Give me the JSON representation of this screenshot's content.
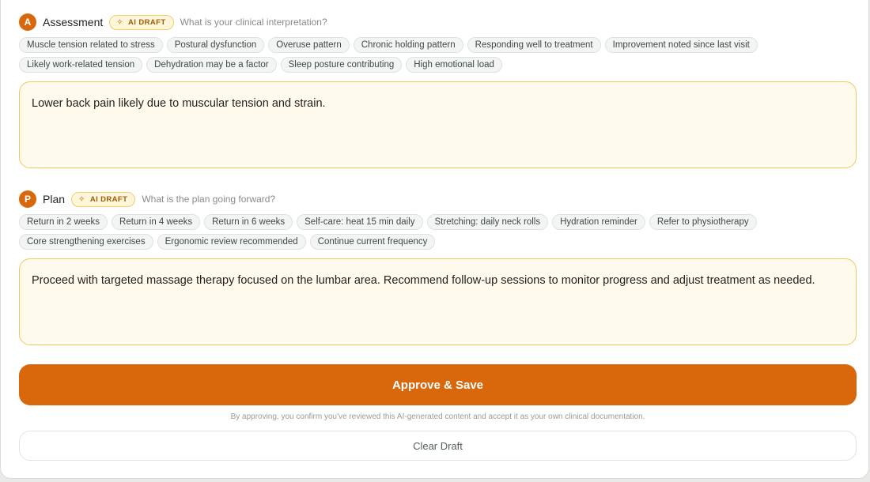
{
  "assessment": {
    "letter": "A",
    "title": "Assessment",
    "badge": "AI DRAFT",
    "prompt": "What is your clinical interpretation?",
    "chips": [
      "Muscle tension related to stress",
      "Postural dysfunction",
      "Overuse pattern",
      "Chronic holding pattern",
      "Responding well to treatment",
      "Improvement noted since last visit",
      "Likely work-related tension",
      "Dehydration may be a factor",
      "Sleep posture contributing",
      "High emotional load"
    ],
    "text": "Lower back pain likely due to muscular tension and strain."
  },
  "plan": {
    "letter": "P",
    "title": "Plan",
    "badge": "AI DRAFT",
    "prompt": "What is the plan going forward?",
    "chips": [
      "Return in 2 weeks",
      "Return in 4 weeks",
      "Return in 6 weeks",
      "Self-care: heat 15 min daily",
      "Stretching: daily neck rolls",
      "Hydration reminder",
      "Refer to physiotherapy",
      "Core strengthening exercises",
      "Ergonomic review recommended",
      "Continue current frequency"
    ],
    "text": "Proceed with targeted massage therapy focused on the lumbar area. Recommend follow-up sessions to monitor progress and adjust treatment as needed."
  },
  "actions": {
    "approve_label": "Approve & Save",
    "disclaimer": "By approving, you confirm you've reviewed this AI-generated content and accept it as your own clinical documentation.",
    "clear_label": "Clear Draft"
  },
  "colors": {
    "accent": "#d9680d",
    "badge_bg": "#fef6d9",
    "textbox_bg": "#fffaeb",
    "textbox_border": "#efc95f"
  },
  "icons": {
    "badge_icon": "sparkle-icon"
  }
}
